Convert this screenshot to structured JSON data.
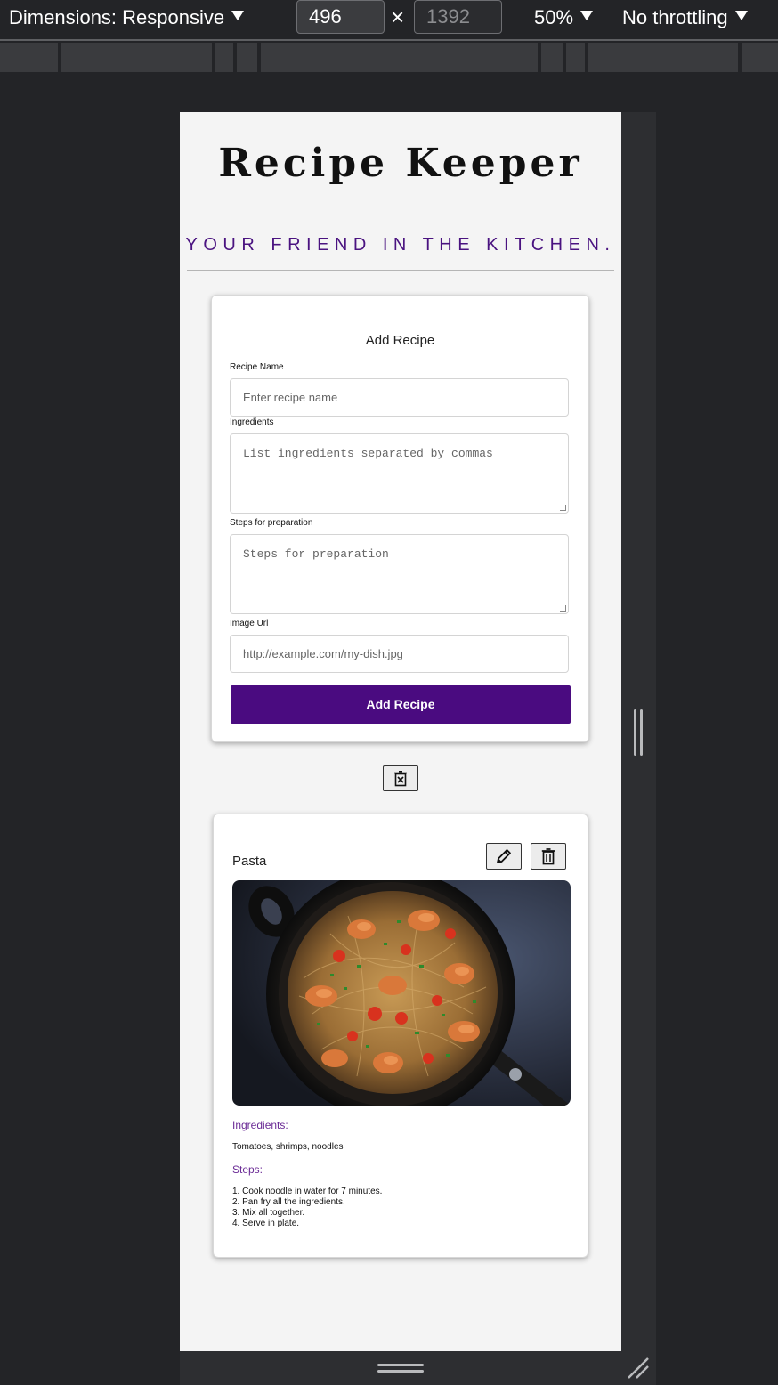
{
  "devtools": {
    "dimensions_label": "Dimensions: Responsive",
    "width_value": "496",
    "height_value": "1392",
    "times": "×",
    "zoom_label": "50%",
    "throttling_label": "No throttling"
  },
  "app": {
    "title": "Recipe Keeper",
    "subtitle": "YOUR FRIEND IN THE KITCHEN."
  },
  "form": {
    "heading": "Add Recipe",
    "name_label": "Recipe Name",
    "name_placeholder": "Enter recipe name",
    "ingredients_label": "Ingredients",
    "ingredients_placeholder": "List ingredients separated by commas",
    "steps_label": "Steps for preparation",
    "steps_placeholder": "Steps for preparation",
    "image_label": "Image Url",
    "image_placeholder": "http://example.com/my-dish.jpg",
    "submit_label": "Add Recipe"
  },
  "recipes": [
    {
      "name": "Pasta",
      "ingredients_title": "Ingredients:",
      "ingredients": "Tomatoes, shrimps, noodles",
      "steps_title": "Steps:",
      "steps": [
        "1. Cook noodle in water for 7 minutes.",
        "2. Pan fry all the ingredients.",
        "3. Mix all together.",
        "4. Serve in plate."
      ]
    }
  ],
  "colors": {
    "accent": "#4a0b80",
    "subtitle": "#4a1380",
    "section_title": "#6a2a95",
    "page_bg": "#f4f4f4"
  },
  "icons": {
    "clear_all": "trash-x-icon",
    "edit": "pencil-icon",
    "delete": "trash-icon"
  }
}
